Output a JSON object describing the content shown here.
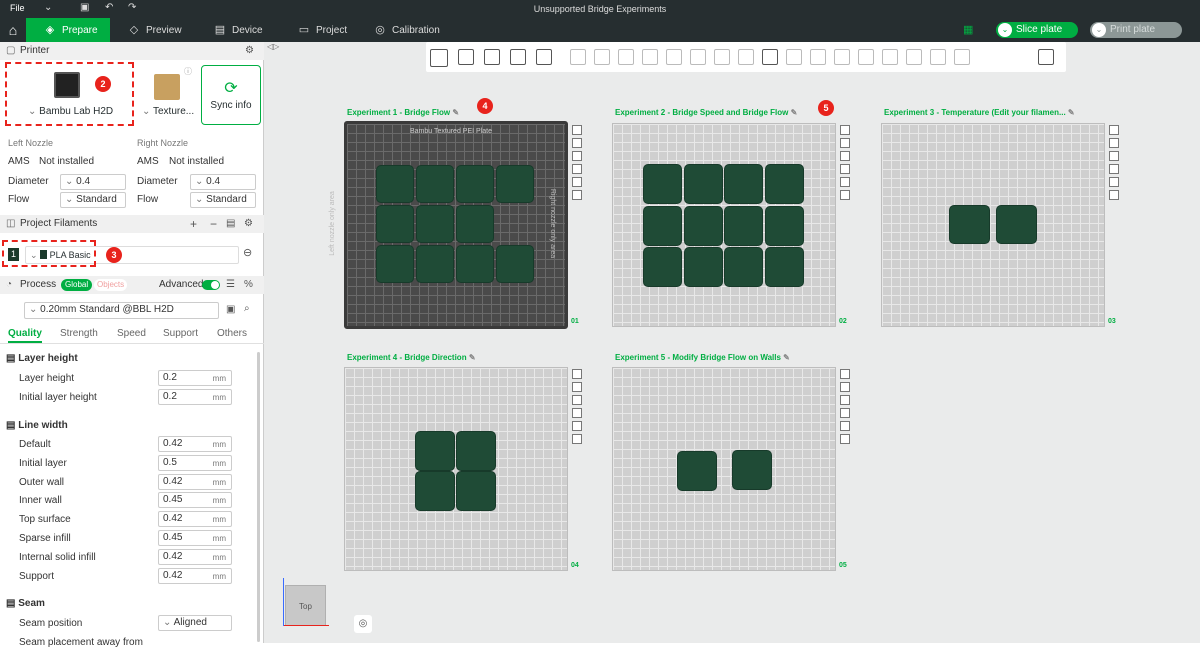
{
  "titlebar": {
    "file": "File",
    "window_title": "Unsupported Bridge Experiments"
  },
  "tabs": [
    {
      "label": "Prepare"
    },
    {
      "label": "Preview"
    },
    {
      "label": "Device"
    },
    {
      "label": "Project"
    },
    {
      "label": "Calibration"
    }
  ],
  "actions": {
    "slice": "Slice plate",
    "print": "Print plate"
  },
  "printer": {
    "section": "Printer",
    "name": "Bambu Lab H2D",
    "plate": "Texture...",
    "sync": "Sync info",
    "left_label": "Left Nozzle",
    "right_label": "Right Nozzle",
    "ams_label": "AMS",
    "ams_value": "Not installed",
    "diameter_label": "Diameter",
    "diameter_value": "0.4",
    "flow_label": "Flow",
    "flow_value": "Standard"
  },
  "filaments": {
    "section": "Project Filaments",
    "index": "1",
    "name": "PLA Basic"
  },
  "process": {
    "section": "Process",
    "global": "Global",
    "objects": "Objects",
    "advanced": "Advanced",
    "preset": "0.20mm Standard @BBL H2D",
    "subtabs": [
      "Quality",
      "Strength",
      "Speed",
      "Support",
      "Others"
    ]
  },
  "settings": {
    "layer_height_group": "Layer height",
    "layer_height": {
      "label": "Layer height",
      "value": "0.2"
    },
    "initial_layer_height": {
      "label": "Initial layer height",
      "value": "0.2"
    },
    "line_width_group": "Line width",
    "lines": [
      {
        "label": "Default",
        "value": "0.42"
      },
      {
        "label": "Initial layer",
        "value": "0.5"
      },
      {
        "label": "Outer wall",
        "value": "0.42"
      },
      {
        "label": "Inner wall",
        "value": "0.45"
      },
      {
        "label": "Top surface",
        "value": "0.42"
      },
      {
        "label": "Sparse infill",
        "value": "0.45"
      },
      {
        "label": "Internal solid infill",
        "value": "0.42"
      },
      {
        "label": "Support",
        "value": "0.42"
      }
    ],
    "unit": "mm",
    "seam_group": "Seam",
    "seam_position": {
      "label": "Seam position",
      "value": "Aligned"
    },
    "seam_cut": "Seam placement away from"
  },
  "plates": [
    {
      "title": "Experiment 1 - Bridge Flow",
      "num": "01"
    },
    {
      "title": "Experiment 2 - Bridge Speed and Bridge Flow",
      "num": "02"
    },
    {
      "title": "Experiment 3 - Temperature (Edit your filamen...",
      "num": "03"
    },
    {
      "title": "Experiment 4 - Bridge Direction",
      "num": "04"
    },
    {
      "title": "Experiment 5 - Modify Bridge Flow on Walls",
      "num": "05"
    }
  ],
  "plate1": {
    "bed": "Bambu Textured PEI Plate",
    "left_only": "Left nozzle only area",
    "right_only": "Right nozzle only area"
  },
  "markers": [
    "2",
    "3",
    "4",
    "5"
  ],
  "view": {
    "cube": "Top"
  },
  "colors": {
    "accent": "#00ae42",
    "marker": "#e8231c",
    "model": "#1f4b36"
  }
}
